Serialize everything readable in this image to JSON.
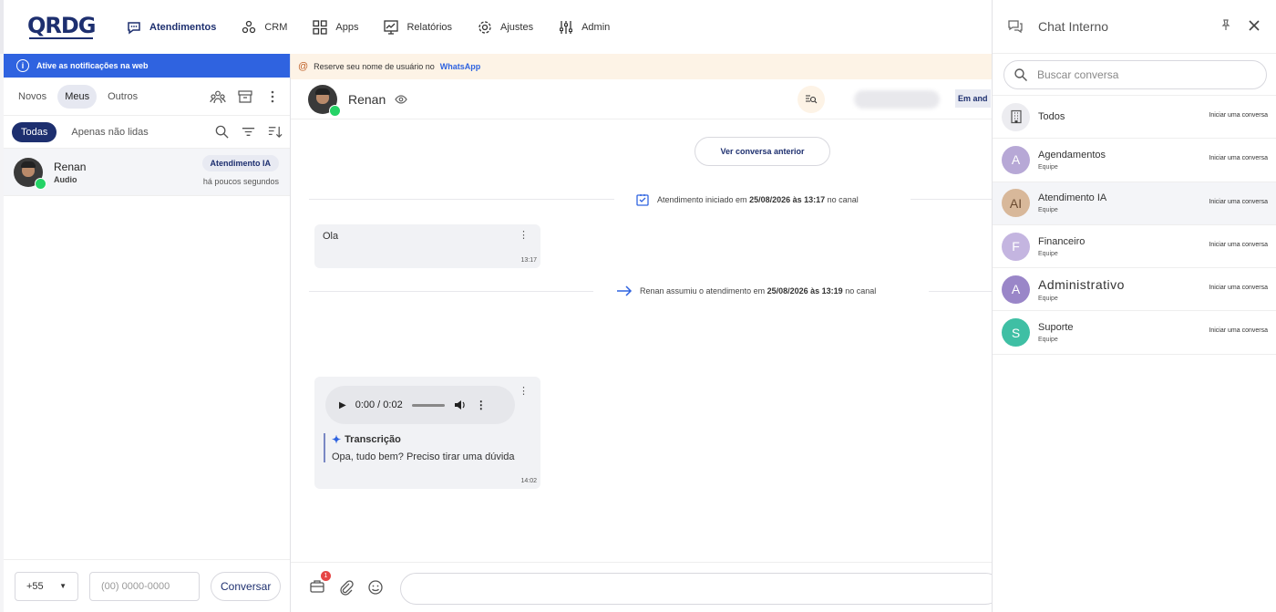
{
  "app": {
    "logo_text": "QRDG",
    "nav": [
      {
        "label": "Atendimentos",
        "icon": "chat-bubble-icon",
        "active": true
      },
      {
        "label": "CRM",
        "icon": "crm-graph-icon"
      },
      {
        "label": "Apps",
        "icon": "apps-grid-icon"
      },
      {
        "label": "Relatórios",
        "icon": "report-chart-icon"
      },
      {
        "label": "Ajustes",
        "icon": "gear-icon"
      },
      {
        "label": "Admin",
        "icon": "sliders-icon"
      }
    ]
  },
  "left": {
    "notification": "Ative as notificações na web",
    "tabs": [
      "Novos",
      "Meus",
      "Outros"
    ],
    "active_tab": "Meus",
    "filters": [
      "Todas",
      "Apenas não lidas"
    ],
    "conversations": [
      {
        "name": "Renan",
        "subtitle": "Audio",
        "badge": "Atendimento IA",
        "time": "há poucos segundos"
      }
    ],
    "bottom": {
      "ddi": "+55",
      "phone_placeholder": "(00) 0000-0000",
      "button": "Conversar"
    }
  },
  "center": {
    "reserve": {
      "prefix": "Reserve seu nome de usuário no",
      "brand": "WhatsApp"
    },
    "contact_name": "Renan",
    "status_label": "Em and",
    "earlier_button": "Ver conversa anterior",
    "system_messages": [
      {
        "text_prefix": "Atendimento iniciado em",
        "bold": "25/08/2026 às 13:17",
        "suffix": "no canal"
      },
      {
        "text_prefix": "Renan assumiu o atendimento em",
        "bold": "25/08/2026 às 13:19",
        "suffix": "no canal"
      }
    ],
    "messages": [
      {
        "text": "Ola",
        "time": "13:17"
      },
      {
        "audio_time": "0:00 / 0:02",
        "transcription_title": "Transcrição",
        "transcription_text": "Opa, tudo bem? Preciso tirar uma dúvida",
        "time": "14:02"
      }
    ],
    "composer": {
      "attach_badge": "1"
    }
  },
  "right": {
    "title": "Chat Interno",
    "search_placeholder": "Buscar conversa",
    "action_label": "Iniciar uma conversa",
    "items": [
      {
        "initial": "",
        "name": "Todos",
        "sub": "",
        "color": "#ececf0",
        "icon": "building-icon"
      },
      {
        "initial": "A",
        "name": "Agendamentos",
        "sub": "Equipe",
        "color": "#b7a8d6"
      },
      {
        "initial": "AI",
        "name": "Atendimento IA",
        "sub": "Equipe",
        "color": "#d8b89a"
      },
      {
        "initial": "F",
        "name": "Financeiro",
        "sub": "Equipe",
        "color": "#c4b5e0"
      },
      {
        "initial": "A",
        "name": "Administrativo",
        "sub": "Equipe",
        "color": "#9a86c8"
      },
      {
        "initial": "S",
        "name": "Suporte",
        "sub": "Equipe",
        "color": "#3fbfa4"
      }
    ]
  }
}
